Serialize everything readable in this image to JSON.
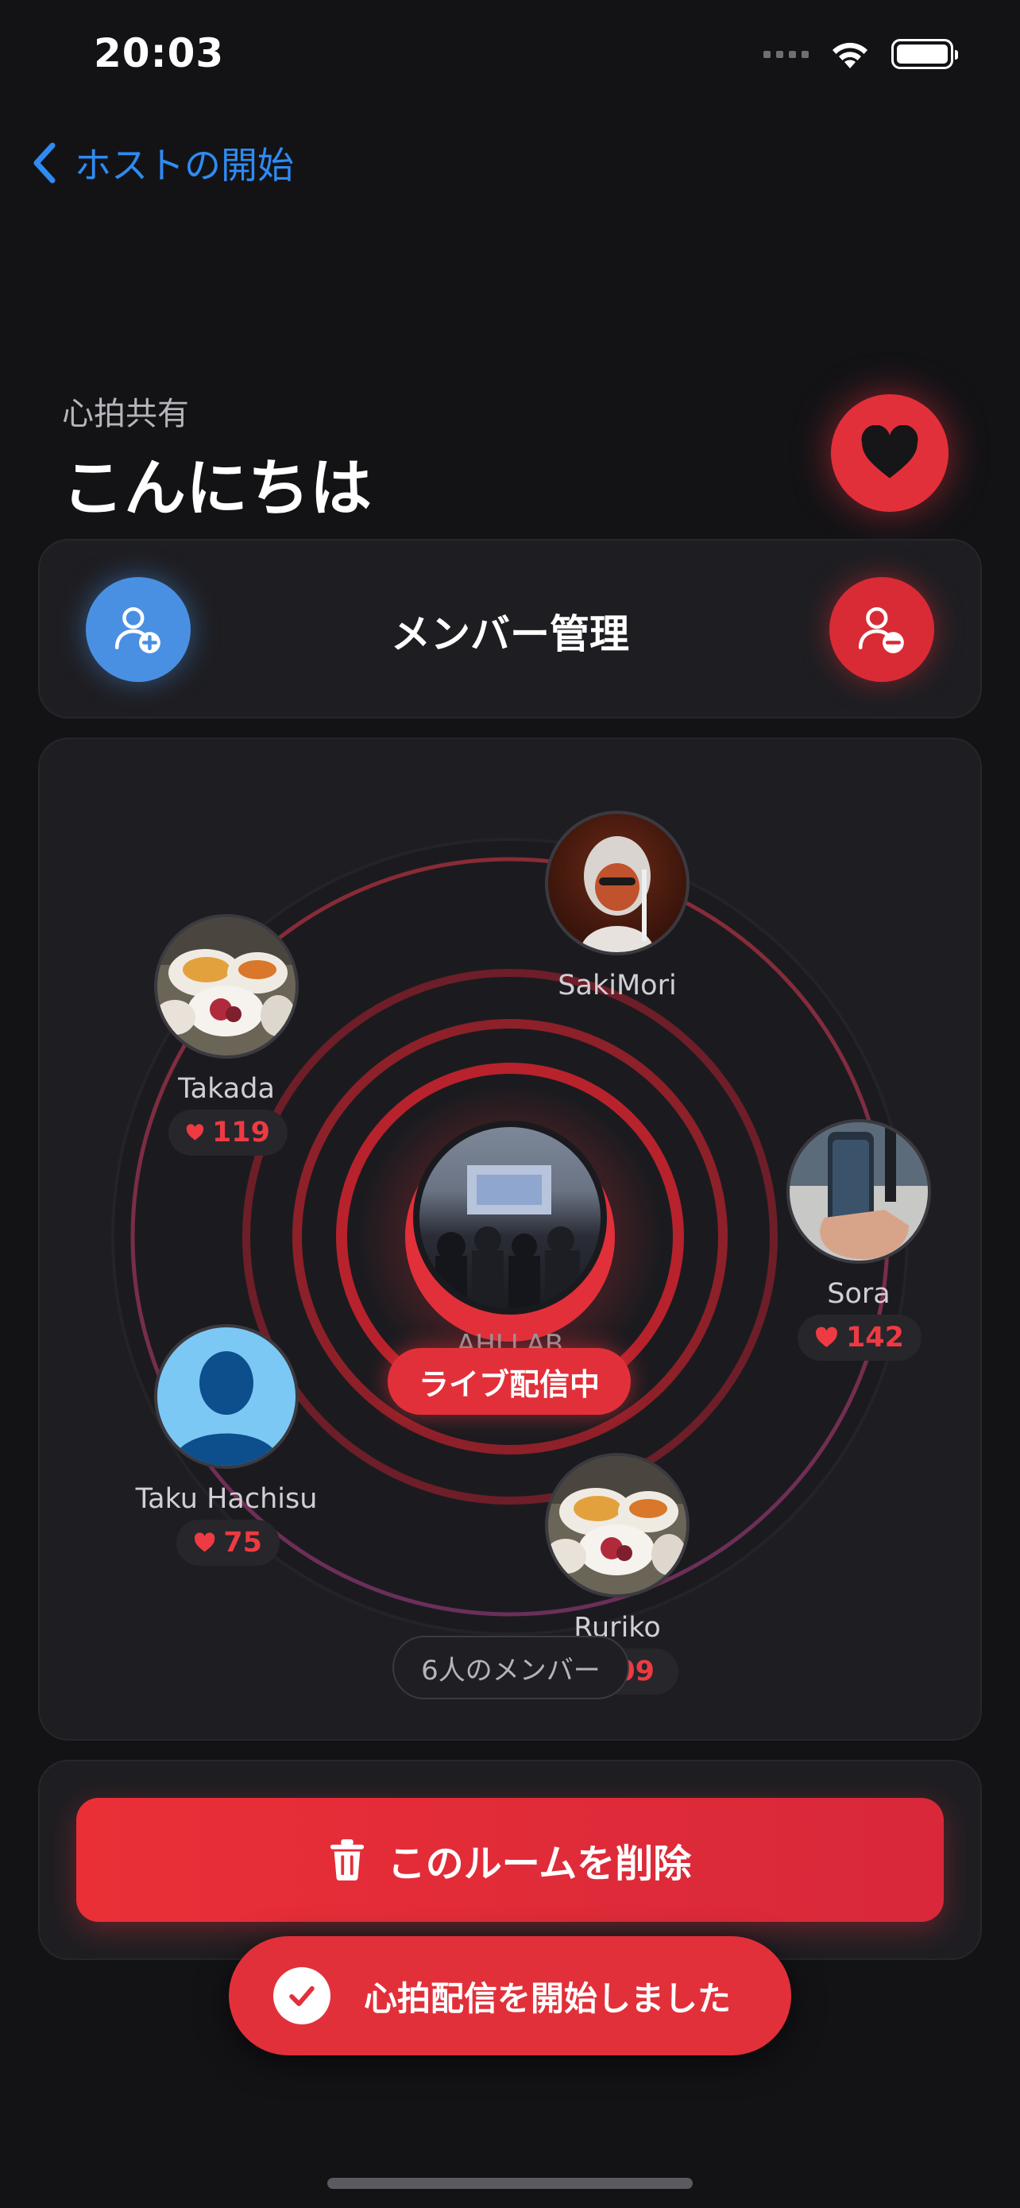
{
  "status_bar": {
    "time": "20:03"
  },
  "nav": {
    "back_label": "ホストの開始"
  },
  "header": {
    "subtitle": "心拍共有",
    "greeting": "こんにちは"
  },
  "members_card": {
    "title": "メンバー管理"
  },
  "graph": {
    "room_name": "AHLLAB",
    "live_label": "ライブ配信中",
    "member_count_label": "6人のメンバー",
    "members": [
      {
        "name": "SakiMori"
      },
      {
        "name": "Takada",
        "bpm": "119"
      },
      {
        "name": "Sora",
        "bpm": "142"
      },
      {
        "name": "Taku Hachisu",
        "bpm": "75"
      },
      {
        "name": "Ruriko",
        "bpm": "09"
      }
    ]
  },
  "delete": {
    "label": "このルームを削除"
  },
  "toast": {
    "message": "心拍配信を開始しました"
  },
  "colors": {
    "accent_red": "#e2303a",
    "accent_blue": "#4a90e2",
    "link_blue": "#2f8bf2",
    "background": "#131316"
  }
}
